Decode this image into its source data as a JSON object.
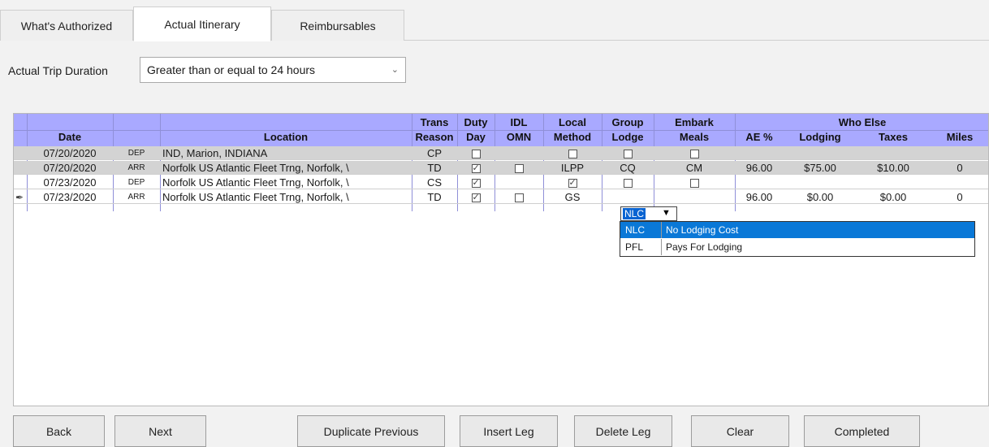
{
  "tabs": [
    {
      "label": "What's Authorized"
    },
    {
      "label": "Actual Itinerary"
    },
    {
      "label": "Reimbursables"
    }
  ],
  "duration": {
    "label": "Actual Trip Duration",
    "value": "Greater than or equal to 24 hours"
  },
  "grid": {
    "headers": {
      "date": "Date",
      "location": "Location",
      "trans_top": "Trans",
      "trans_bot": "Reason",
      "duty_top": "Duty",
      "duty_bot": "Day",
      "idl_top": "IDL",
      "idl_bot": "OMN",
      "local_top": "Local",
      "local_bot": "Method",
      "group_top": "Group",
      "group_bot": "Lodge",
      "embark_top": "Embark",
      "embark_bot": "Meals",
      "who_else": "Who Else",
      "ae": "AE %",
      "lodging": "Lodging",
      "taxes": "Taxes",
      "miles": "Miles"
    },
    "rows": [
      {
        "date": "07/20/2020",
        "type": "DEP",
        "location": "IND, Marion, INDIANA",
        "trans": "CP",
        "duty": false,
        "idl": null,
        "local": null,
        "local_cb": false,
        "group": null,
        "group_cb": false,
        "embark": null,
        "embark_cb": false,
        "ae": "",
        "lodging": "",
        "taxes": "",
        "miles": ""
      },
      {
        "date": "07/20/2020",
        "type": "ARR",
        "location": "Norfolk US Atlantic Fleet Trng, Norfolk, \\",
        "trans": "TD",
        "duty": true,
        "idl": false,
        "local": "ILPP",
        "group": "CQ",
        "embark": "CM",
        "ae": "96.00",
        "lodging": "$75.00",
        "taxes": "$10.00",
        "miles": "0"
      },
      {
        "date": "07/23/2020",
        "type": "DEP",
        "location": "Norfolk US Atlantic Fleet Trng, Norfolk, \\",
        "trans": "CS",
        "duty": true,
        "idl": null,
        "local_cb": true,
        "group_cb": false,
        "embark_cb": false,
        "ae": "",
        "lodging": "",
        "taxes": "",
        "miles": ""
      },
      {
        "date": "07/23/2020",
        "type": "ARR",
        "location": "Norfolk US Atlantic Fleet Trng, Norfolk, \\",
        "trans": "TD",
        "duty": true,
        "idl": false,
        "local": "GS",
        "group": "NLC",
        "embark": "",
        "ae": "96.00",
        "lodging": "$0.00",
        "taxes": "$0.00",
        "miles": "0"
      }
    ],
    "dropdown": {
      "options": [
        {
          "code": "NLC",
          "desc": "No Lodging Cost"
        },
        {
          "code": "PFL",
          "desc": "Pays For Lodging"
        }
      ]
    }
  },
  "buttons": {
    "back": "Back",
    "next": "Next",
    "duplicate": "Duplicate Previous",
    "insert": "Insert Leg",
    "delete": "Delete Leg",
    "clear": "Clear",
    "completed": "Completed"
  },
  "colors": {
    "header": "#a9a9ff",
    "row_shade": "#d3d3d3",
    "selection": "#0a78d7"
  }
}
